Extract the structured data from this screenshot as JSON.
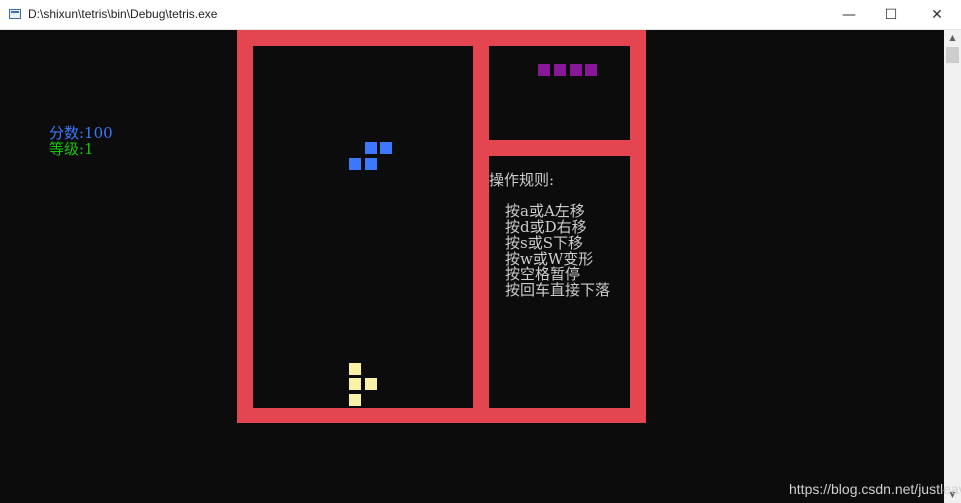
{
  "window": {
    "title": "D:\\shixun\\tetris\\bin\\Debug\\tetris.exe",
    "minimize_glyph": "—",
    "maximize_glyph": "☐",
    "close_glyph": "✕"
  },
  "game": {
    "score_text": "分数:100",
    "level_text": "等级:1",
    "rules_title": "操作规则:",
    "rules": [
      "按a或A左移",
      "按d或D右移",
      "按s或S下移",
      "按w或W变形",
      "按空格暂停",
      "按回车直接下落"
    ],
    "colors": {
      "border": "#e44551",
      "falling_piece": "#3b78ff",
      "next_piece": "#881798",
      "landed_piece": "#f9f1a5",
      "score": "#3b78ff",
      "level": "#16c60c"
    },
    "falling_piece_type": "S",
    "next_piece_type": "I",
    "landed_piece_type": "T"
  },
  "watermark": "https://blog.csdn.net/justleav"
}
